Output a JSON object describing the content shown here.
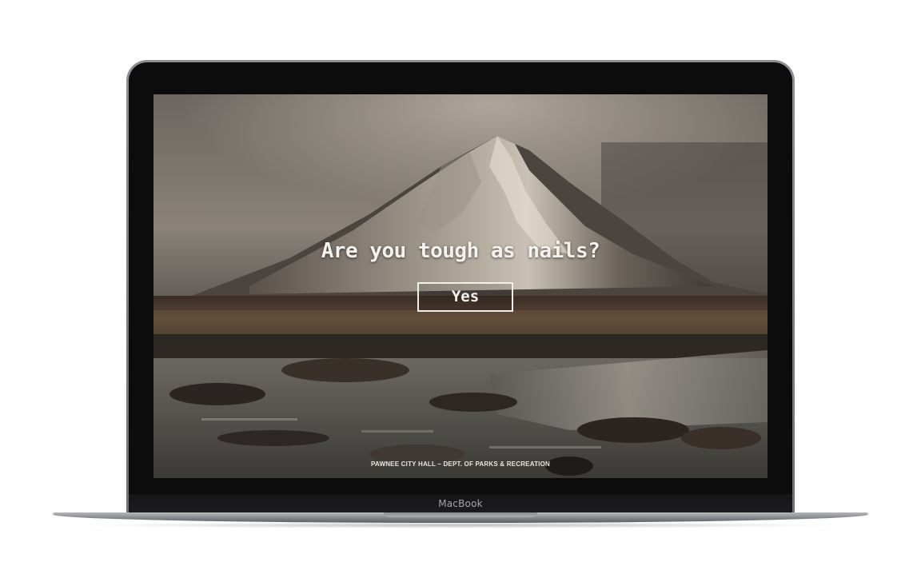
{
  "device": {
    "brand_label": "MacBook"
  },
  "page": {
    "headline": "Are you tough as nails?",
    "cta_label": "Yes",
    "footer": "PAWNEE CITY HALL – DEPT. OF PARKS & RECREATION"
  },
  "colors": {
    "text": "#f4f2ee",
    "bezel": "#0c0c0d",
    "shell": "#8d8f93"
  },
  "icons": {
    "background": "mountain-landscape-photo"
  }
}
